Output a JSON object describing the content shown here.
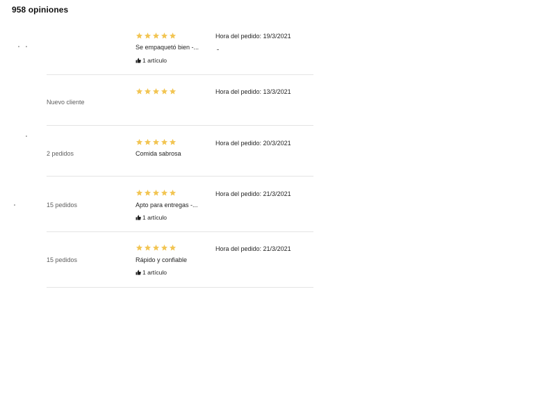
{
  "header": {
    "review_count": "958 opiniones"
  },
  "colors": {
    "star": "#f2c553",
    "divider": "#e4e4e4"
  },
  "reviews": [
    {
      "customer_meta": "",
      "rating": 5,
      "comment": "Se empaquetó bien -...",
      "items": "1 artículo",
      "order_time": "Hora del pedido: 19/3/2021"
    },
    {
      "customer_meta": "Nuevo cliente",
      "rating": 5,
      "comment": "",
      "items": "",
      "order_time": "Hora del pedido: 13/3/2021"
    },
    {
      "customer_meta": "2 pedidos",
      "rating": 5,
      "comment": "Comida sabrosa",
      "items": "",
      "order_time": "Hora del pedido: 20/3/2021"
    },
    {
      "customer_meta": "15 pedidos",
      "rating": 5,
      "comment": "Apto para entregas -...",
      "items": "1 artículo",
      "order_time": "Hora del pedido: 21/3/2021"
    },
    {
      "customer_meta": "15 pedidos",
      "rating": 5,
      "comment": "Rápido y confiable",
      "items": "1 artículo",
      "order_time": "Hora del pedido: 21/3/2021"
    }
  ]
}
